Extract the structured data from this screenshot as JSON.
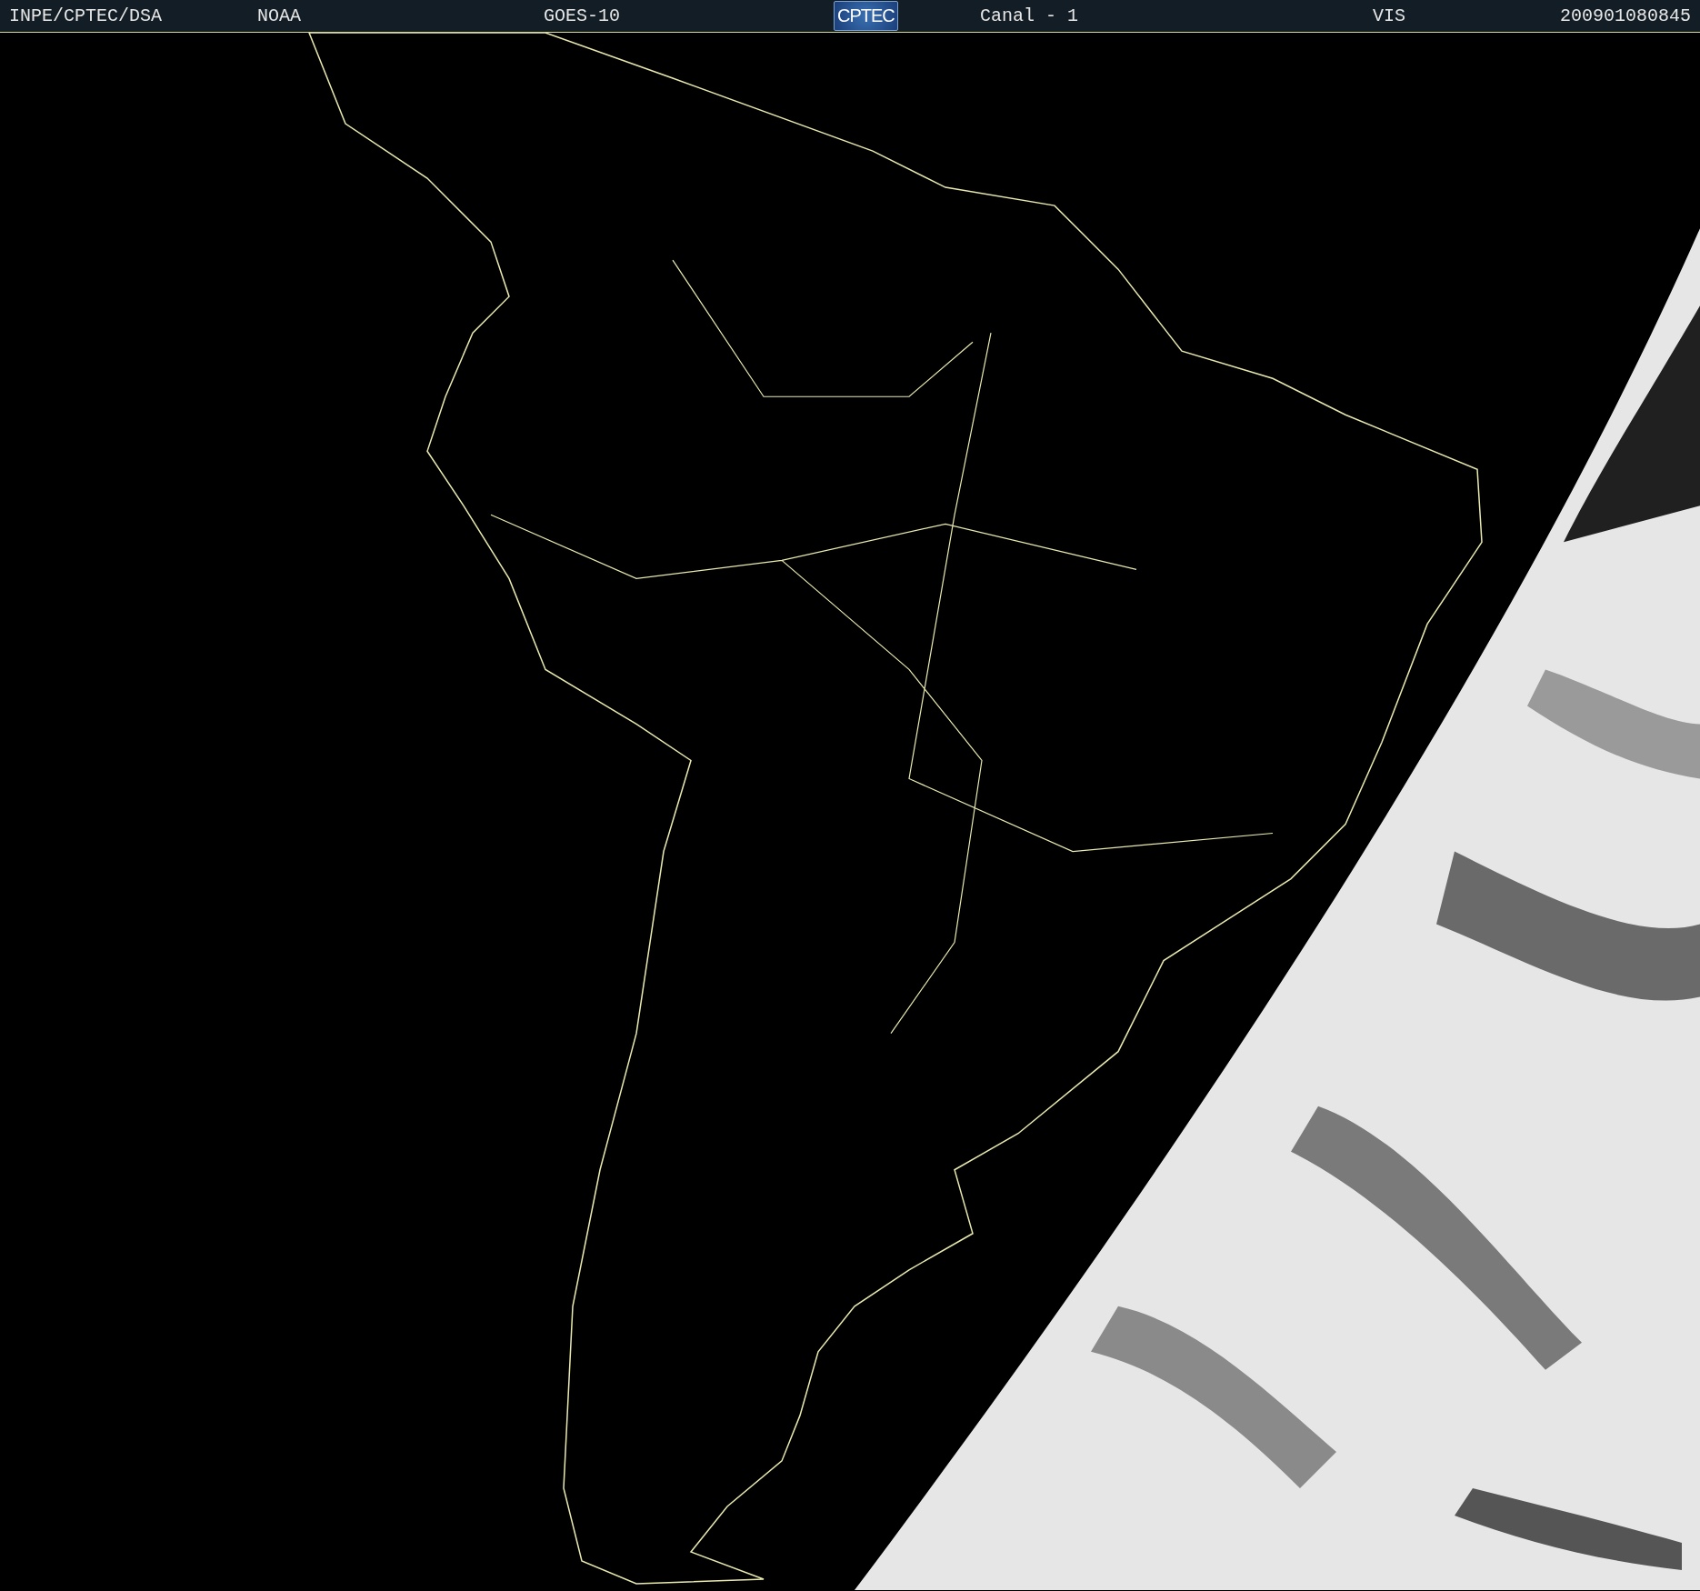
{
  "header": {
    "organization": "INPE/CPTEC/DSA",
    "agency": "NOAA",
    "satellite": "GOES-10",
    "logo": "CPTEC",
    "channel": "Canal - 1",
    "band": "VIS",
    "timestamp": "200901080845"
  }
}
